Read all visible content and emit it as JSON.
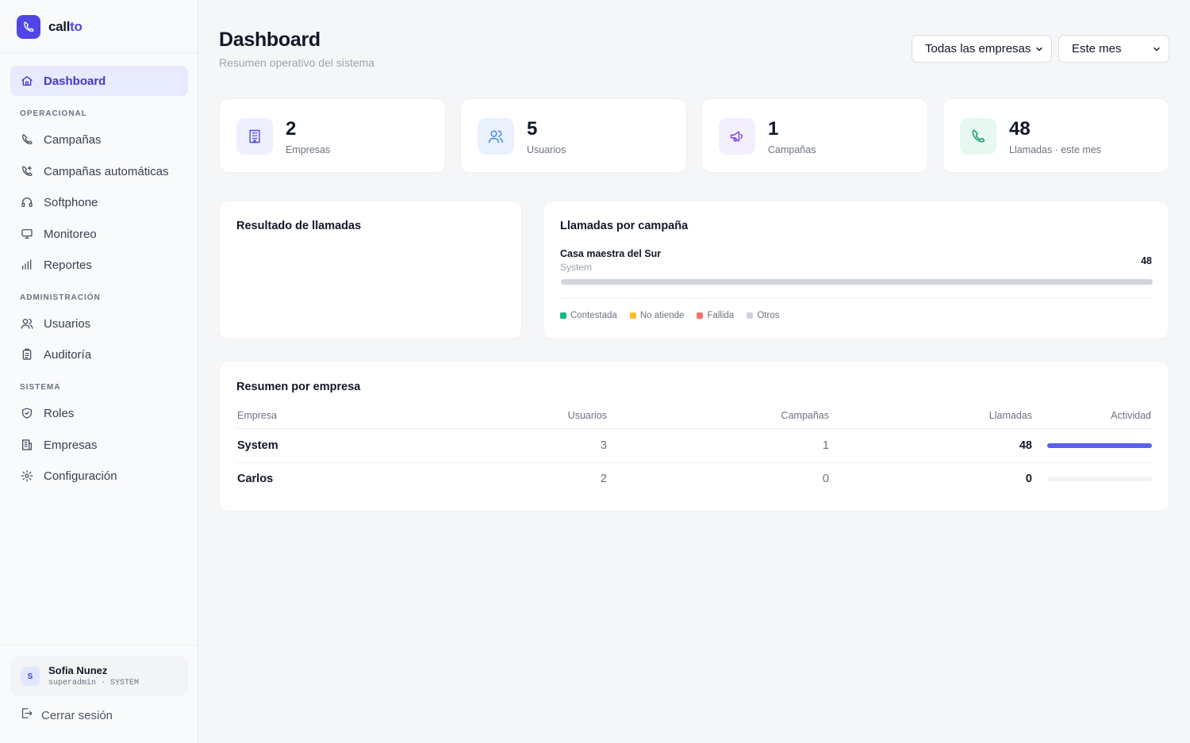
{
  "brand": {
    "part1": "call",
    "part2": "to"
  },
  "colors": {
    "accent": "#4f46e5",
    "active_bg": "#e7ebfd"
  },
  "nav": {
    "dashboard": "Dashboard",
    "section_operacional": "OPERACIONAL",
    "campanas": "Campañas",
    "campanas_auto": "Campañas automáticas",
    "softphone": "Softphone",
    "monitoreo": "Monitoreo",
    "reportes": "Reportes",
    "section_admin": "ADMINISTRACIÓN",
    "usuarios": "Usuarios",
    "auditoria": "Auditoría",
    "section_sistema": "SISTEMA",
    "roles": "Roles",
    "empresas": "Empresas",
    "configuracion": "Configuración"
  },
  "user": {
    "initial": "S",
    "name": "Sofia Nunez",
    "role": "superadmin · SYSTEM"
  },
  "logout_label": "Cerrar sesión",
  "header": {
    "title": "Dashboard",
    "subtitle": "Resumen operativo del sistema",
    "company_filter": "Todas las empresas",
    "period_filter": "Este mes"
  },
  "stats": [
    {
      "value": "2",
      "label": "Empresas",
      "icon": "building-icon"
    },
    {
      "value": "5",
      "label": "Usuarios",
      "icon": "users-icon"
    },
    {
      "value": "1",
      "label": "Campañas",
      "icon": "megaphone-icon"
    },
    {
      "value": "48",
      "label": "Llamadas · este mes",
      "icon": "phone-icon"
    }
  ],
  "results_card": {
    "title": "Resultado de llamadas"
  },
  "campaign_card": {
    "title": "Llamadas por campaña",
    "campaigns": [
      {
        "name": "Casa maestra del Sur",
        "company": "System",
        "calls": "48",
        "fill_fraction": 1.0
      }
    ],
    "legend": [
      {
        "label": "Contestada",
        "color": "#10b981"
      },
      {
        "label": "No atiende",
        "color": "#fbbf24"
      },
      {
        "label": "Fallida",
        "color": "#f87171"
      },
      {
        "label": "Otros",
        "color": "#d1d5db"
      }
    ]
  },
  "summary": {
    "title": "Resumen por empresa",
    "columns": [
      "Empresa",
      "Usuarios",
      "Campañas",
      "Llamadas",
      "Actividad"
    ],
    "rows": [
      {
        "empresa": "System",
        "usuarios": "3",
        "campanas": "1",
        "llamadas": "48",
        "activity": 1.0
      },
      {
        "empresa": "Carlos",
        "usuarios": "2",
        "campanas": "0",
        "llamadas": "0",
        "activity": 0.0
      }
    ]
  }
}
